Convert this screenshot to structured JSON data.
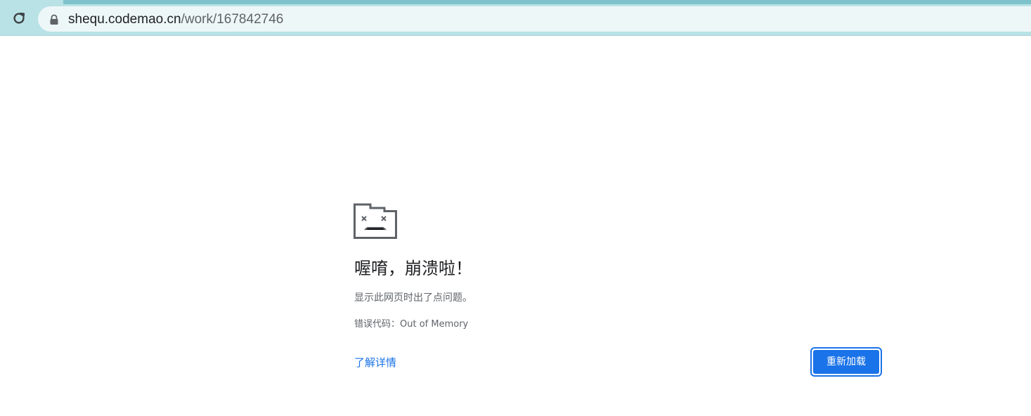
{
  "browser": {
    "url_domain": "shequ.codemao.cn",
    "url_path": "/work/167842746",
    "icons": {
      "reload": "reload-icon",
      "lock": "lock-icon"
    }
  },
  "error_page": {
    "icon": "sad-folder-icon",
    "title": "喔唷，崩溃啦！",
    "description": "显示此网页时出了点问题。",
    "error_code": "错误代码：Out of Memory",
    "learn_more_label": "了解详情",
    "reload_label": "重新加载",
    "colors": {
      "accent": "#1a73e8",
      "text": "#202124",
      "secondary": "#5f6368"
    }
  }
}
